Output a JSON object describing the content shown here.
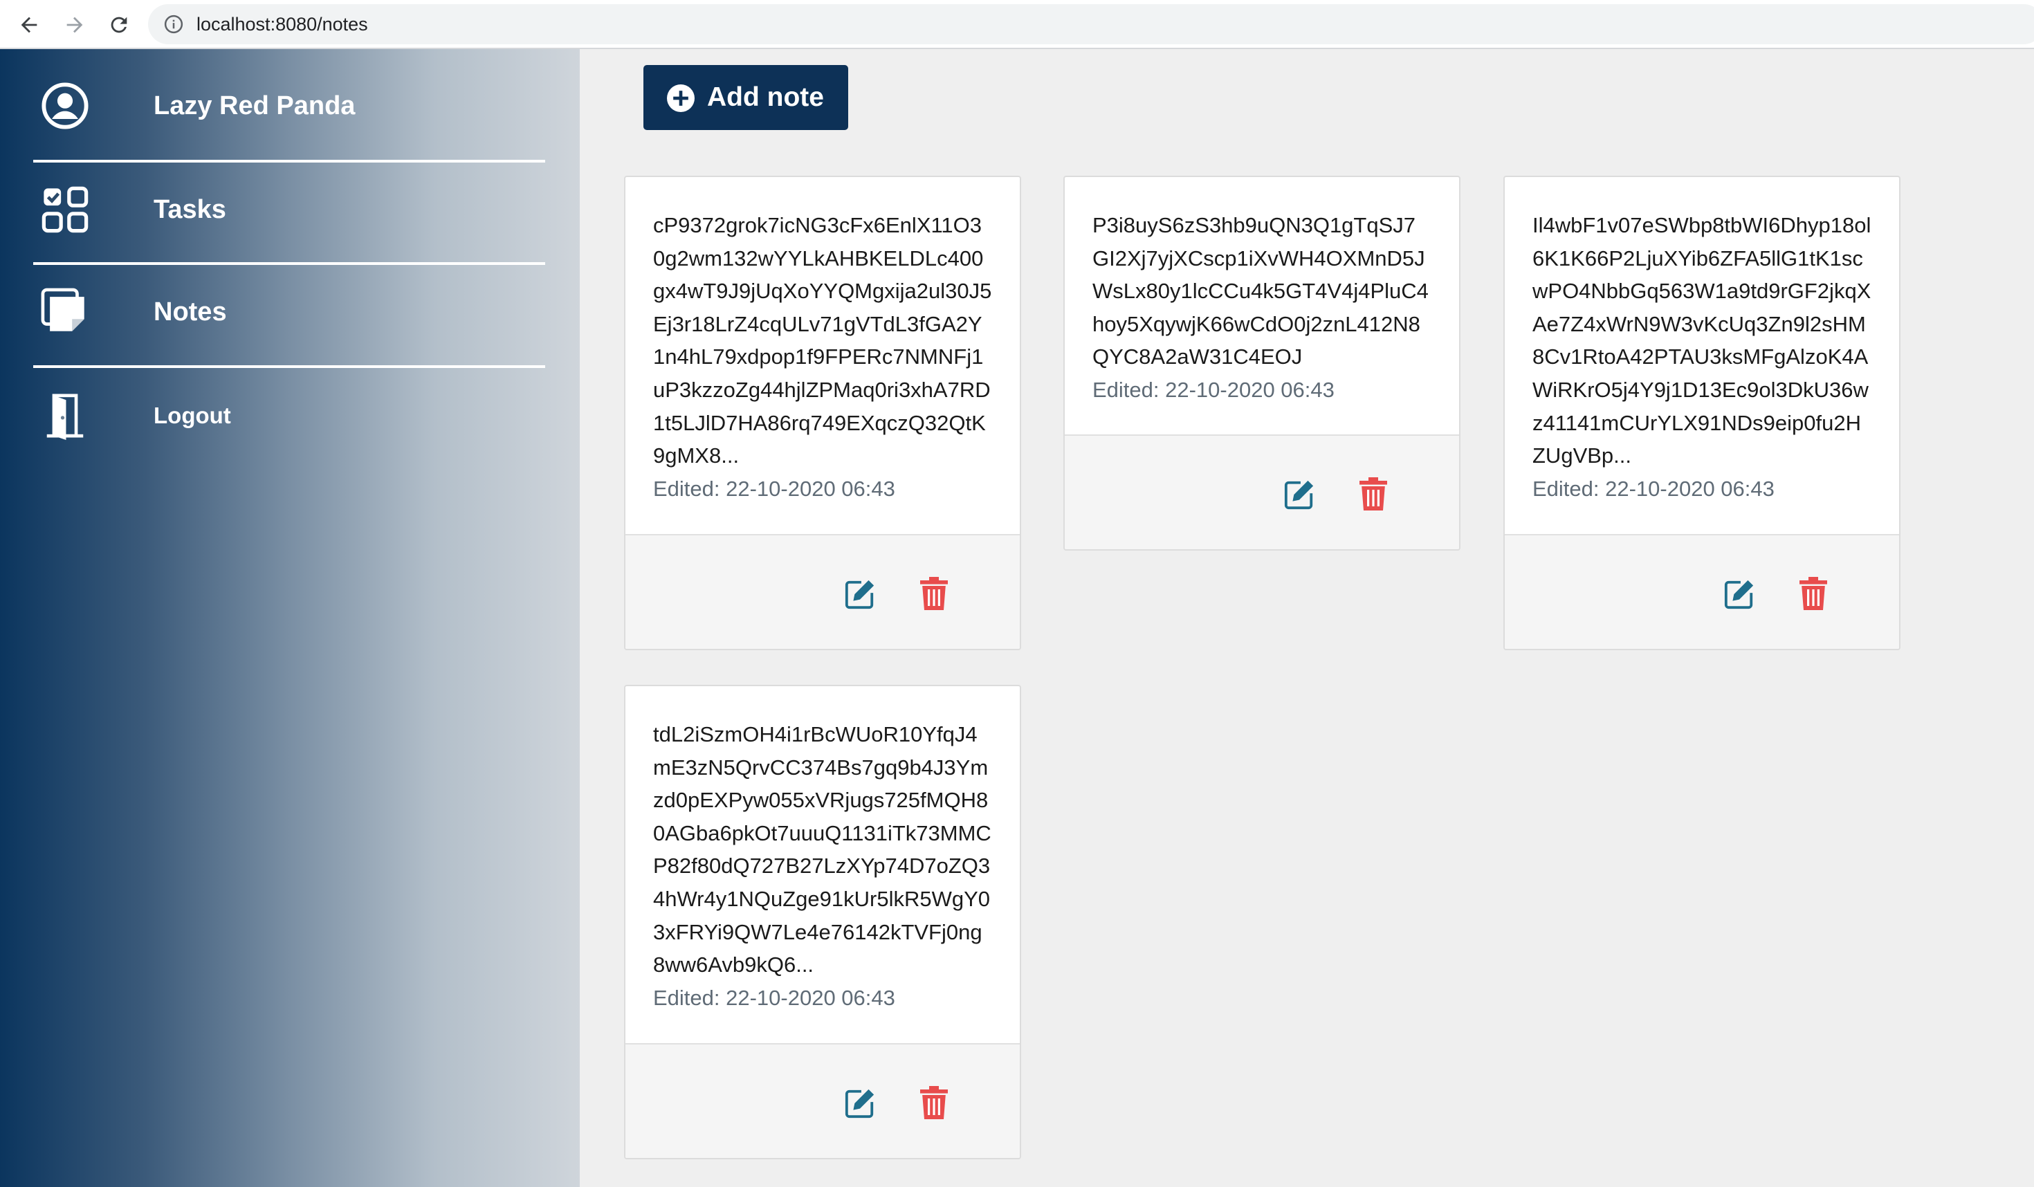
{
  "browser": {
    "url": "localhost:8080/notes",
    "icons": [
      "back-arrow-icon",
      "forward-arrow-icon",
      "reload-icon",
      "info-icon"
    ]
  },
  "sidebar": {
    "username": "Lazy Red Panda",
    "items": [
      {
        "label": "Tasks",
        "icon": "tasks-icon"
      },
      {
        "label": "Notes",
        "icon": "notes-icon"
      },
      {
        "label": "Logout",
        "icon": "door-icon"
      }
    ]
  },
  "main": {
    "add_note_label": "Add note",
    "notes": [
      {
        "text": "cP9372grok7icNG3cFx6EnlX11O30g2wm132wYYLkAHBKELDLc400gx4wT9J9jUqXoYYQMgxija2ul30J5Ej3r18LrZ4cqULv71gVTdL3fGA2Y1n4hL79xdpop1f9FPERc7NMNFj1uP3kzzoZg44hjlZPMaq0ri3xhA7RD1t5LJlD7HA86rq749EXqczQ32QtK9gMX8...",
        "edited": "Edited: 22-10-2020 06:43"
      },
      {
        "text": "P3i8uyS6zS3hb9uQN3Q1gTqSJ7GI2Xj7yjXCscp1iXvWH4OXMnD5JWsLx80y1lcCCu4k5GT4V4j4PluC4hoy5XqywjK66wCdO0j2znL412N8QYC8A2aW31C4EOJ",
        "edited": "Edited: 22-10-2020 06:43"
      },
      {
        "text": "Il4wbF1v07eSWbp8tbWI6Dhyp18ol6K1K66P2LjuXYib6ZFA5llG1tK1scwPO4NbbGq563W1a9td9rGF2jkqXAe7Z4xWrN9W3vKcUq3Zn9l2sHM8Cv1RtoA42PTAU3ksMFgAlzoK4AWiRKrO5j4Y9j1D13Ec9ol3DkU36wz41141mCUrYLX91NDs9eip0fu2HZUgVBp...",
        "edited": "Edited: 22-10-2020 06:43"
      },
      {
        "text": "tdL2iSzmOH4i1rBcWUoR10YfqJ4mE3zN5QrvCC374Bs7gq9b4J3Ymzd0pEXPyw055xVRjugs725fMQH80AGba6pkOt7uuuQ1131iTk73MMCP82f80dQ727B27LzXYp74D7oZQ34hWr4y1NQuZge91kUr5lkR5WgY03xFRYi9QW7Le4e76142kTVFj0ng8ww6Avb9kQ6...",
        "edited": "Edited: 22-10-2020 06:43"
      }
    ]
  },
  "colors": {
    "sidebar_dark": "#0b355e",
    "button": "#0d3157",
    "edit_icon": "#1f6e8c",
    "delete_icon": "#e84c4c"
  }
}
